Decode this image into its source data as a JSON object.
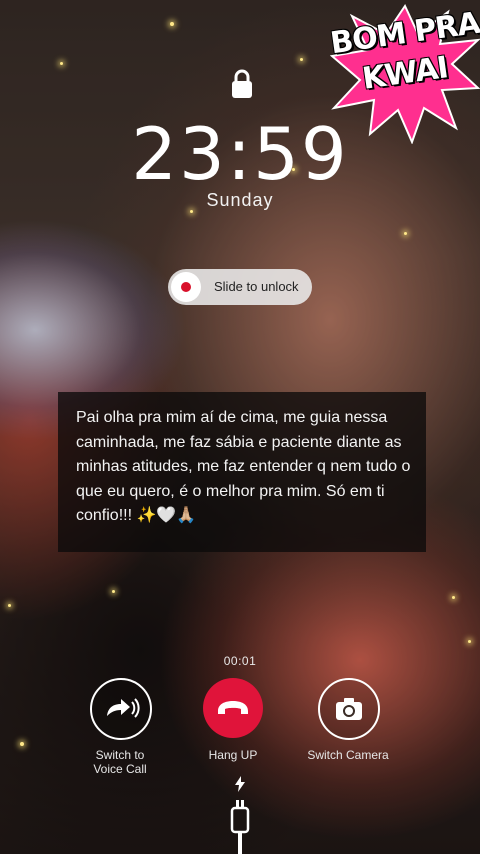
{
  "badge": {
    "line1": "BOM PRA",
    "line2": "KWAI"
  },
  "lock_screen": {
    "time": "23:59",
    "day": "Sunday",
    "slider_label": "Slide to unlock"
  },
  "message": "Pai olha pra mim aí de cima, me guia nessa caminhada, me faz sábia e paciente diante as minhas atitudes, me faz entender q nem tudo o que eu quero, é o melhor pra mim. Só em ti confio!!! ✨🤍🙏🏼",
  "call": {
    "duration": "00:01",
    "switch_voice_label": "Switch to\nVoice Call",
    "hang_up_label": "Hang UP",
    "switch_camera_label": "Switch Camera"
  },
  "colors": {
    "hang_up": "#e0143a",
    "slider_dot": "#d8102a",
    "badge_pink": "#ff2f8f"
  },
  "icons": [
    "lock-icon",
    "switch-voice-icon",
    "hang-up-icon",
    "camera-icon",
    "bolt-icon",
    "charger-icon"
  ]
}
